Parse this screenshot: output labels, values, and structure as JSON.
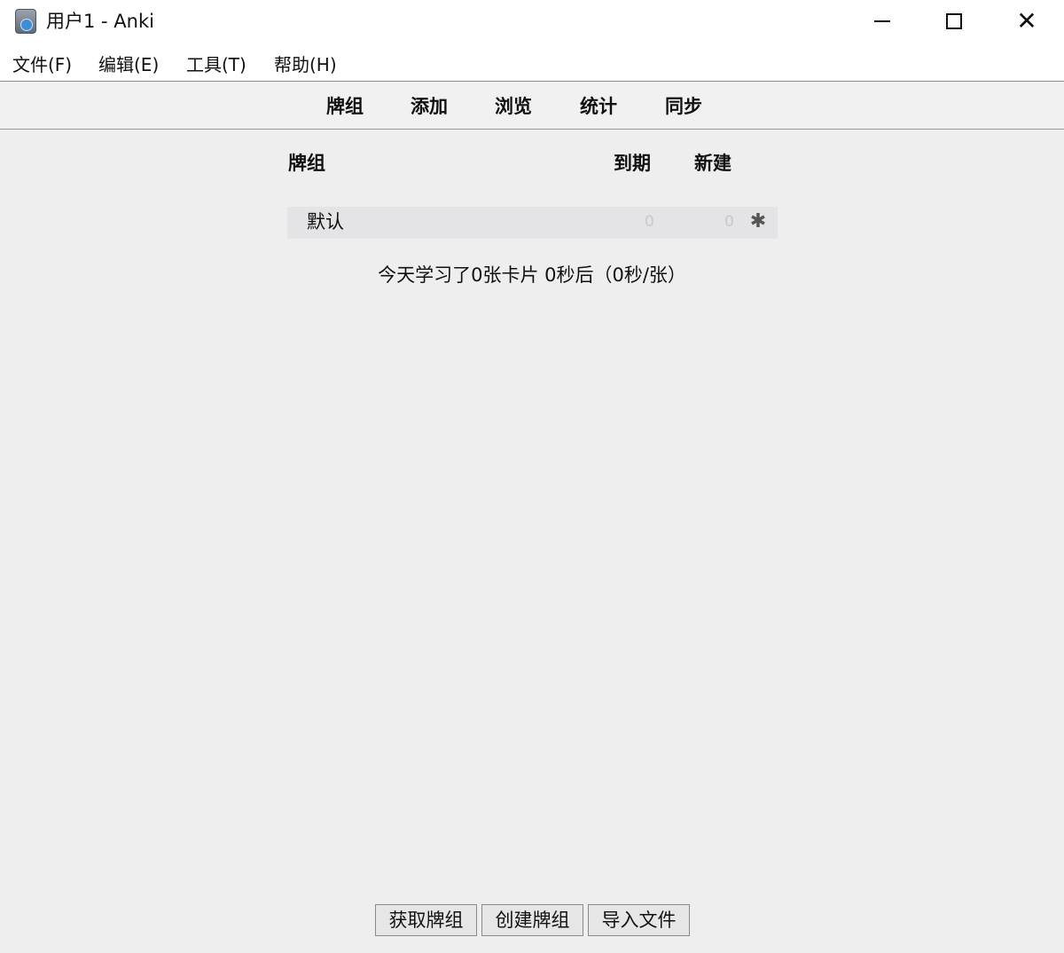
{
  "window": {
    "title": "用户1 - Anki",
    "icon": "anki-app-icon",
    "controls": {
      "minimize": "minimize-icon",
      "maximize": "maximize-icon",
      "close": "✕"
    }
  },
  "menubar": {
    "items": [
      {
        "label": "文件(F)"
      },
      {
        "label": "编辑(E)"
      },
      {
        "label": "工具(T)"
      },
      {
        "label": "帮助(H)"
      }
    ]
  },
  "toolbar": {
    "items": [
      {
        "label": "牌组"
      },
      {
        "label": "添加"
      },
      {
        "label": "浏览"
      },
      {
        "label": "统计"
      },
      {
        "label": "同步"
      }
    ]
  },
  "deck_table": {
    "headers": {
      "deck": "牌组",
      "due": "到期",
      "new": "新建"
    },
    "rows": [
      {
        "name": "默认",
        "due": "0",
        "new": "0",
        "options_icon": "gear-icon"
      }
    ]
  },
  "study_summary": "今天学习了0张卡片 0秒后（0秒/张）",
  "bottom_buttons": {
    "get_decks": "获取牌组",
    "create_deck": "创建牌组",
    "import_file": "导入文件"
  },
  "colors": {
    "background": "#efeeef",
    "titlebar": "#ffffff",
    "deck_row": "#e4e3e5",
    "muted_count": "#c8c8c8"
  }
}
